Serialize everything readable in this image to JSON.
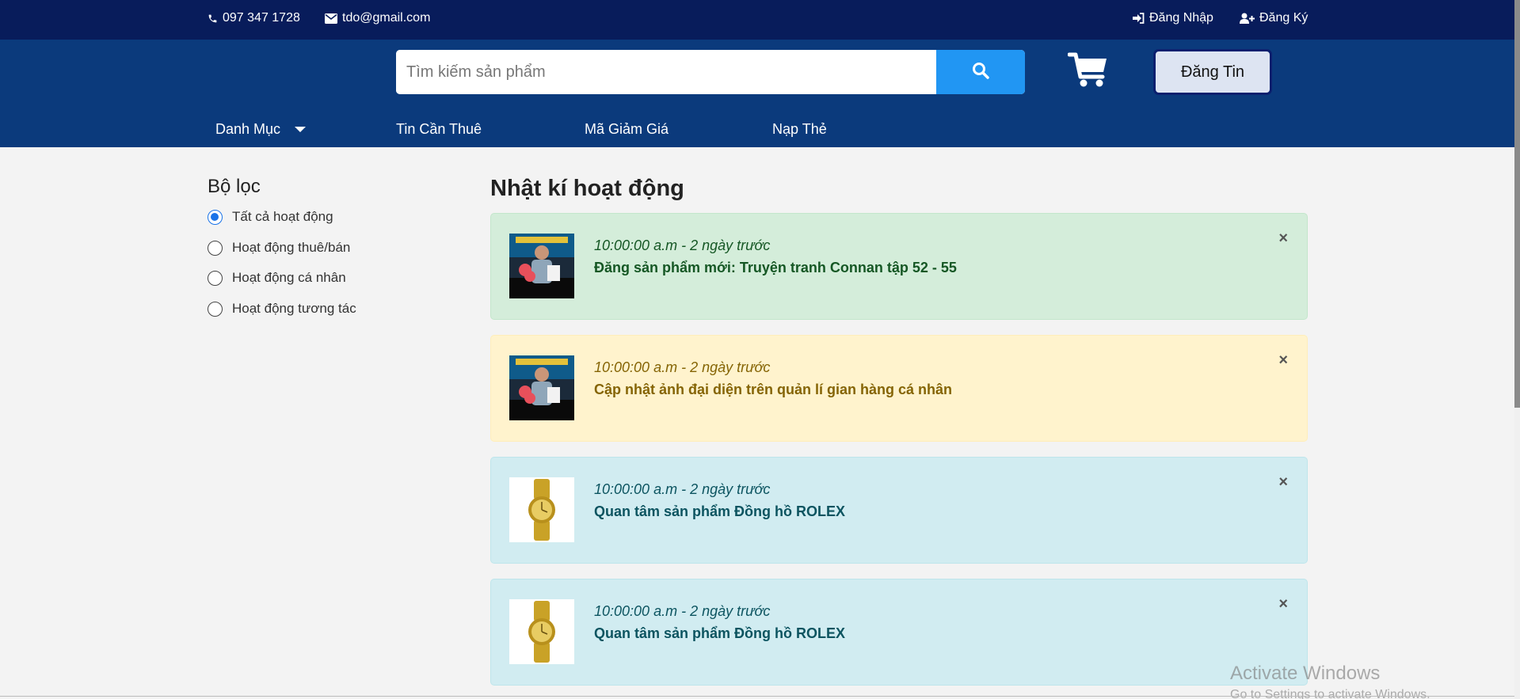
{
  "topbar": {
    "phone": "097 347 1728",
    "email": "tdo@gmail.com",
    "login": "Đăng Nhập",
    "register": "Đăng Ký"
  },
  "header": {
    "search_placeholder": "Tìm kiếm sản phẩm",
    "post_button": "Đăng Tin",
    "nav": {
      "categories": "Danh Mục",
      "rent_posts": "Tin Cần Thuê",
      "discount": "Mã Giảm Giá",
      "topup": "Nạp Thẻ"
    }
  },
  "sidebar": {
    "title": "Bộ lọc",
    "options": [
      {
        "label": "Tất cả hoạt động",
        "checked": true
      },
      {
        "label": "Hoạt động thuê/bán",
        "checked": false
      },
      {
        "label": "Hoạt động cá nhân",
        "checked": false
      },
      {
        "label": "Hoạt động tương tác",
        "checked": false
      }
    ]
  },
  "main": {
    "title": "Nhật kí hoạt động",
    "activities": [
      {
        "time": "10:00:00 a.m - 2 ngày trước",
        "message": "Đăng sản phẩm mới: Truyện tranh Connan tập 52 - 55",
        "status": "success",
        "thumb": "person-photo"
      },
      {
        "time": "10:00:00 a.m - 2 ngày trước",
        "message": "Cập nhật ảnh đại diện trên quản lí gian hàng cá nhân",
        "status": "warning",
        "thumb": "person-photo"
      },
      {
        "time": "10:00:00 a.m - 2 ngày trước",
        "message": "Quan tâm sản phẩm Đồng hồ ROLEX",
        "status": "info",
        "thumb": "watch-photo"
      },
      {
        "time": "10:00:00 a.m - 2 ngày trước",
        "message": "Quan tâm sản phẩm Đồng hồ ROLEX",
        "status": "info",
        "thumb": "watch-photo"
      }
    ],
    "close_symbol": "×"
  },
  "watermark": {
    "line1": "Activate Windows",
    "line2": "Go to Settings to activate Windows."
  },
  "colors": {
    "topbar": "#081c5b",
    "header": "#0b3a7c",
    "search_button": "#2196f3",
    "success_bg": "#d4edda",
    "warning_bg": "#fff3cd",
    "info_bg": "#d1ecf1"
  }
}
